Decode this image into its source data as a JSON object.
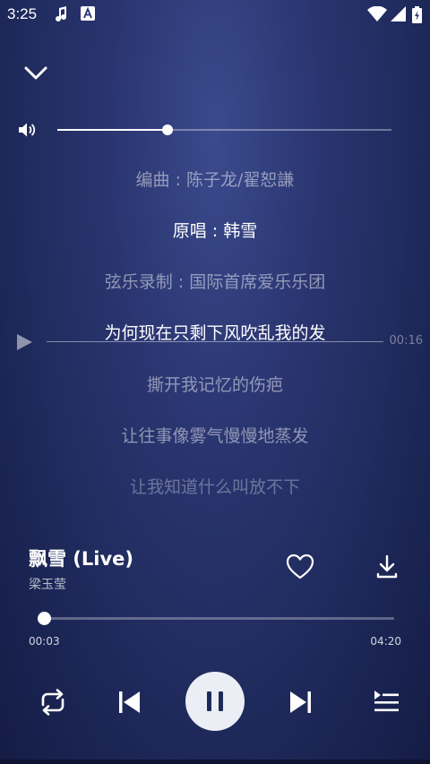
{
  "status_bar": {
    "time": "3:25",
    "icons": [
      "music-note-icon",
      "notification-a-icon",
      "wifi-icon",
      "signal-icon",
      "battery-charging-icon"
    ]
  },
  "header": {
    "collapse_icon": "chevron-down-icon"
  },
  "volume": {
    "icon": "speaker-icon",
    "level": 0.33
  },
  "lyrics": {
    "lines": [
      "编曲 : 陈子龙/翟恕謙",
      "原唱 : 韩雪",
      "弦乐录制 : 国际首席爱乐乐团",
      "为何现在只剩下风吹乱我的发",
      "撕开我记忆的伤疤",
      "让往事像雾气慢慢地蒸发",
      "让我知道什么叫放不下"
    ],
    "current_index": 1,
    "seek_time": "00:16"
  },
  "song": {
    "title": "飘雪 (Live)",
    "artist": "梁玉莹"
  },
  "progress": {
    "current": "00:03",
    "total": "04:20",
    "fraction": 0.012
  },
  "controls": {
    "repeat_icon": "repeat-icon",
    "prev_icon": "skip-previous-icon",
    "pause_icon": "pause-icon",
    "next_icon": "skip-next-icon",
    "playlist_icon": "playlist-icon"
  },
  "colors": {
    "accent": "#ffffff",
    "background": "#1f2a5c",
    "pause_button": "#eceef5"
  }
}
